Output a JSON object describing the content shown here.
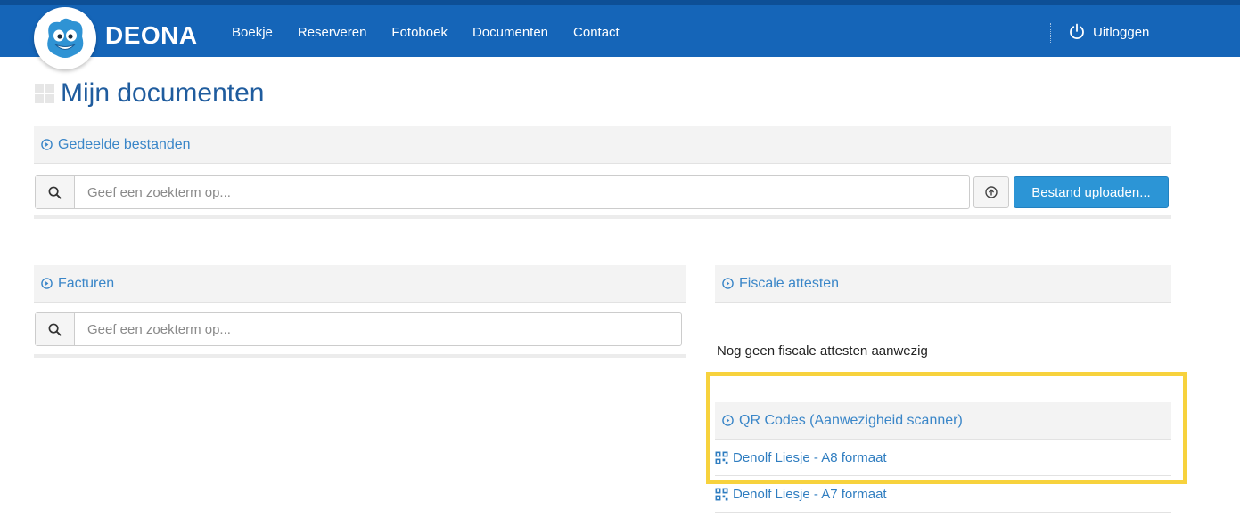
{
  "header": {
    "brand": "DEONA",
    "nav": [
      "Boekje",
      "Reserveren",
      "Fotoboek",
      "Documenten",
      "Contact"
    ],
    "logout_label": "Uitloggen"
  },
  "page": {
    "title": "Mijn documenten"
  },
  "shared_files": {
    "title": "Gedeelde bestanden",
    "search_placeholder": "Geef een zoekterm op...",
    "upload_label": "Bestand uploaden..."
  },
  "invoices": {
    "title": "Facturen",
    "search_placeholder": "Geef een zoekterm op..."
  },
  "tax_certificates": {
    "title": "Fiscale attesten",
    "empty_message": "Nog geen fiscale attesten aanwezig"
  },
  "qr_codes": {
    "title": "QR Codes (Aanwezigheid scanner)",
    "items": [
      {
        "label": "Denolf Liesje - A8 formaat"
      },
      {
        "label": "Denolf Liesje - A7 formaat"
      }
    ]
  },
  "colors": {
    "nav_bg": "#1565b8",
    "accent": "#3a86c8",
    "primary_button": "#2c95d6",
    "highlight": "#f7d23d"
  },
  "icons": {
    "logo": "smiley-mascot-icon",
    "logout": "power-icon",
    "search": "search-icon",
    "upload": "upload-circle-icon",
    "panel_toggle": "circle-arrow-icon",
    "qr": "qr-code-icon",
    "title": "grid-icon"
  }
}
